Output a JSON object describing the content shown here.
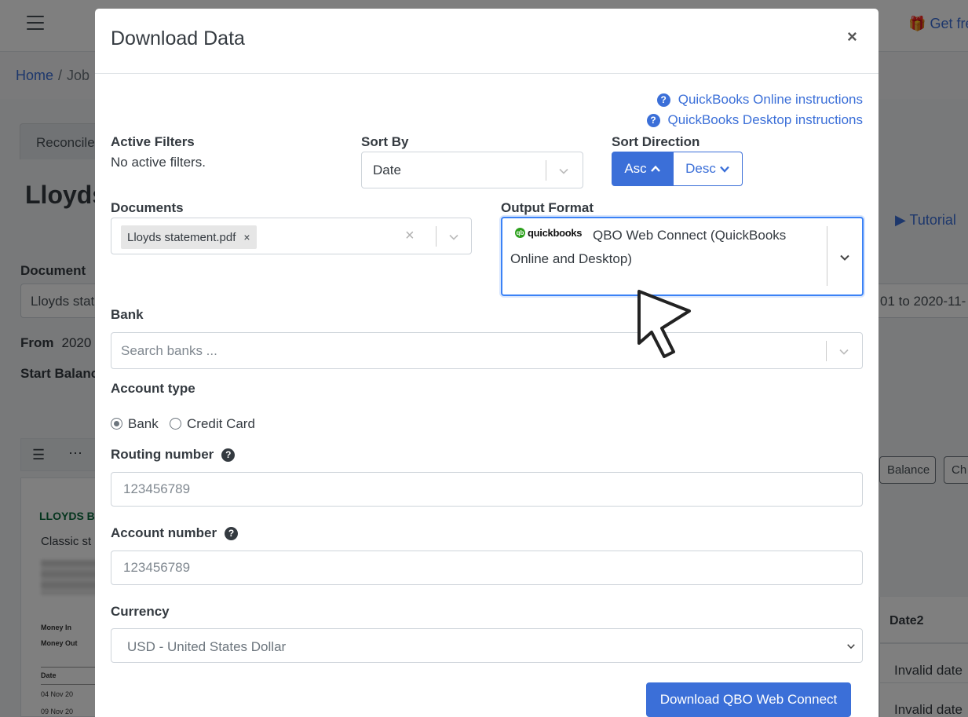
{
  "background": {
    "get_free": "Get fre",
    "breadcrumb_home": "Home",
    "breadcrumb_sep": "/",
    "breadcrumb_jobs": "Job",
    "tab_reconcile": "Reconcile",
    "page_title": "Lloyds",
    "tutorial": "Tutorial",
    "document_label": "Document",
    "document_value": "Lloyds stat",
    "date_range": "01 to 2020-11-",
    "from_label": "From",
    "from_value": "2020",
    "start_balance_label": "Start Balanc",
    "balance_button": "Balance",
    "ch_button": "Ch",
    "pdf_bank_name": "LLOYDS B",
    "pdf_subtitle": "Classic st",
    "pdf_money_in": "Money In",
    "pdf_money_out": "Money Out",
    "pdf_date_header": "Date",
    "pdf_date_1": "04 Nov 20",
    "pdf_date_2": "09 Nov 20",
    "table_header_date2": "Date2",
    "table_cell_1": "Invalid date",
    "table_cell_2": "Invalid date"
  },
  "modal": {
    "title": "Download Data",
    "close": "×",
    "qbo_online_link": "QuickBooks Online instructions",
    "qbo_desktop_link": "QuickBooks Desktop instructions",
    "active_filters_label": "Active Filters",
    "active_filters_value": "No active filters.",
    "sort_by_label": "Sort By",
    "sort_by_value": "Date",
    "sort_direction_label": "Sort Direction",
    "asc_label": "Asc",
    "desc_label": "Desc",
    "documents_label": "Documents",
    "document_tag": "Lloyds statement.pdf",
    "tag_remove": "×",
    "clear_all": "×",
    "output_format_label": "Output Format",
    "qb_logo_text": "quickbooks",
    "output_format_value": "QBO Web Connect (QuickBooks Online and Desktop)",
    "bank_label": "Bank",
    "bank_placeholder": "Search banks ...",
    "account_type_label": "Account type",
    "account_type_options": [
      "Bank",
      "Credit Card"
    ],
    "account_type_selected": "Bank",
    "routing_label": "Routing number",
    "routing_placeholder": "123456789",
    "account_number_label": "Account number",
    "account_number_placeholder": "123456789",
    "currency_label": "Currency",
    "currency_value": "USD - United States Dollar",
    "download_button": "Download QBO Web Connect"
  },
  "colors": {
    "primary": "#3b6fd8",
    "focus_border": "#3b82f6",
    "quickbooks_green": "#2ca01c"
  }
}
